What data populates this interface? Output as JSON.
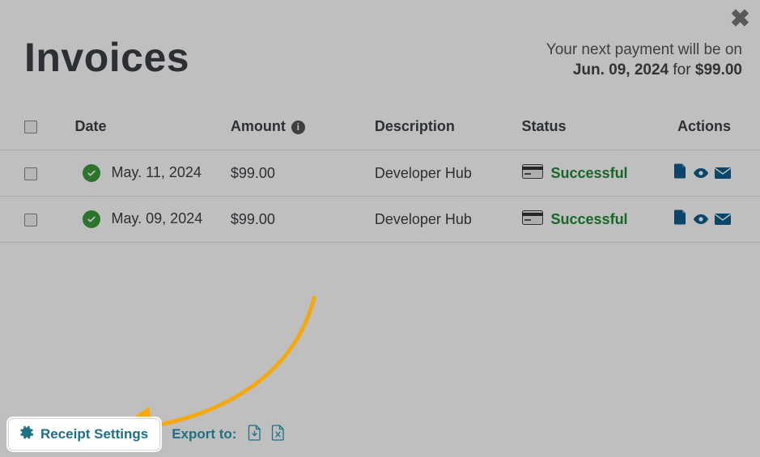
{
  "header": {
    "title": "Invoices",
    "next_payment_intro": "Your next payment will be on",
    "next_payment_date": "Jun. 09, 2024",
    "next_payment_for": "for",
    "next_payment_amount": "$99.00"
  },
  "columns": {
    "date": "Date",
    "amount": "Amount",
    "description": "Description",
    "status": "Status",
    "actions": "Actions"
  },
  "rows": [
    {
      "date": "May. 11, 2024",
      "amount": "$99.00",
      "description": "Developer Hub",
      "status": "Successful"
    },
    {
      "date": "May. 09, 2024",
      "amount": "$99.00",
      "description": "Developer Hub",
      "status": "Successful"
    }
  ],
  "footer": {
    "receipt_settings": "Receipt Settings",
    "export_to": "Export to:"
  }
}
